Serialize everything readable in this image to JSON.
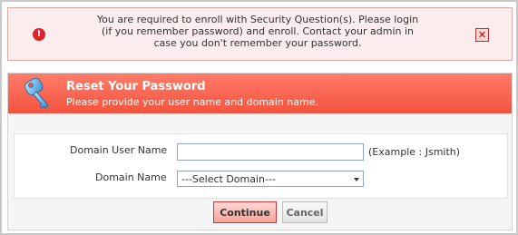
{
  "alert": {
    "icon": "error-icon",
    "line1": "You are required to enroll with Security Question(s). Please login",
    "line2": "(if you remember password) and enroll. Contact your admin in",
    "line3": "case you don't remember your password.",
    "close_icon": "close-icon"
  },
  "header": {
    "icon": "key-icon",
    "title": "Reset Your Password",
    "subtitle": "Please provide your user name and domain name."
  },
  "form": {
    "user_label": "Domain User Name",
    "user_value": "",
    "user_example": "(Example : Jsmith)",
    "domain_label": "Domain Name",
    "domain_selected": "---Select Domain---"
  },
  "actions": {
    "continue_label": "Continue",
    "cancel_label": "Cancel"
  },
  "colors": {
    "header": "#f4533d",
    "alert_bg": "#fbeded",
    "alert_border": "#e8a3a3"
  }
}
